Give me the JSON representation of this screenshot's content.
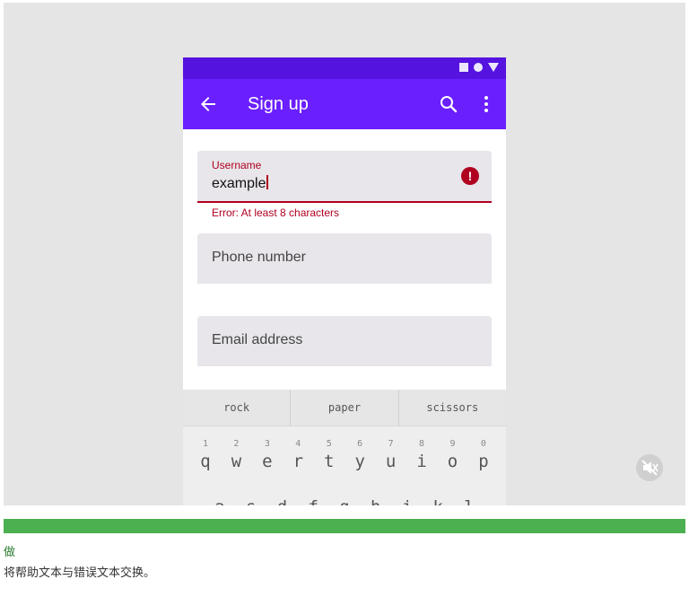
{
  "appbar": {
    "title": "Sign up"
  },
  "username": {
    "label": "Username",
    "value": "example",
    "helper": "Error: At least 8 characters",
    "error_icon": "!"
  },
  "phone": {
    "placeholder": "Phone number"
  },
  "email": {
    "placeholder": "Email address"
  },
  "keyboard": {
    "suggestions": [
      "rock",
      "paper",
      "scissors"
    ],
    "numbers": [
      "1",
      "2",
      "3",
      "4",
      "5",
      "6",
      "7",
      "8",
      "9",
      "0"
    ],
    "row1": [
      "q",
      "w",
      "e",
      "r",
      "t",
      "y",
      "u",
      "i",
      "o",
      "p"
    ],
    "row2_partial": [
      "a",
      "s",
      "d",
      "f",
      "g",
      "h",
      "j",
      "k",
      "l"
    ]
  },
  "caption": {
    "label": "做",
    "text": "将帮助文本与错误文本交换。"
  },
  "colors": {
    "appbar": "#6a1fff",
    "statusbar": "#5513e0",
    "error": "#b00020",
    "do": "#4caf50"
  }
}
